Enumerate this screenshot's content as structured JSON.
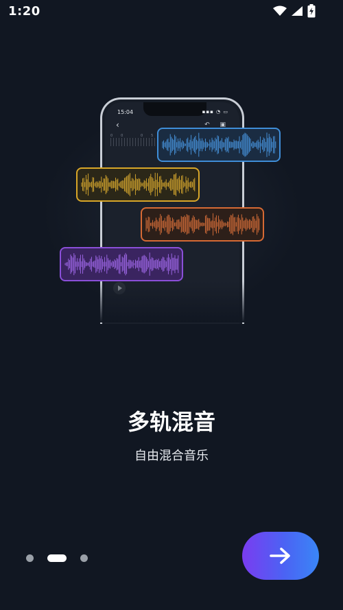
{
  "status_bar": {
    "time": "1:20",
    "icons": [
      "wifi-icon",
      "cellular-signal-icon",
      "battery-charging-icon"
    ]
  },
  "illustration": {
    "phone": {
      "time": "15:04",
      "status_icons": "▪▪▪ ◔ ▭",
      "back_glyph": "‹",
      "tool_glyphs": "↶ ▣",
      "ruler_numbers": "00 05 10 15"
    },
    "tracks": [
      {
        "name": "blue",
        "color": "#3f8ed8"
      },
      {
        "name": "yellow",
        "color": "#d9a728"
      },
      {
        "name": "orange",
        "color": "#d76a34"
      },
      {
        "name": "purple",
        "color": "#8b4fd9"
      }
    ]
  },
  "onboarding": {
    "title": "多轨混音",
    "subtitle": "自由混合音乐",
    "page_count": 3,
    "active_page": 2
  },
  "next_button": {
    "icon": "arrow-right-icon",
    "gradient": [
      "#7a3cf0",
      "#3a86f6"
    ]
  }
}
